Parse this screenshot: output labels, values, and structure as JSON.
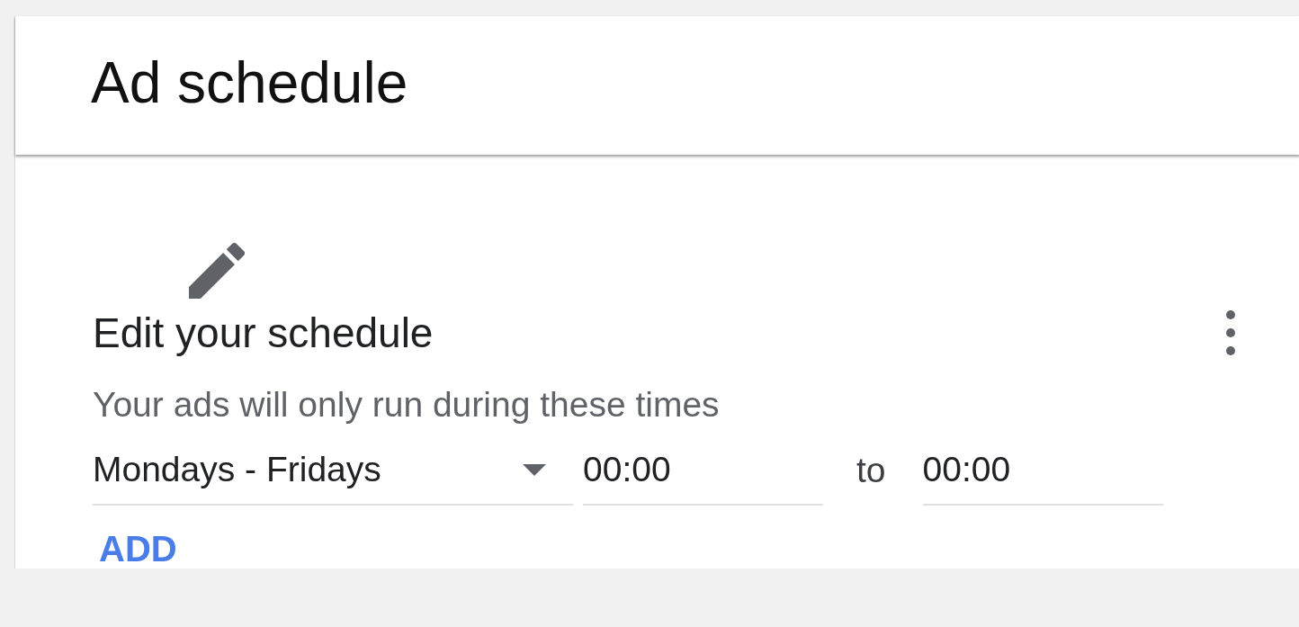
{
  "title": "Ad schedule",
  "section": {
    "title": "Edit your schedule",
    "subtitle": "Your ads will only run during these times"
  },
  "schedule_row": {
    "days": {
      "value": "Mondays - Fridays"
    },
    "start": {
      "value": "00:00"
    },
    "separator": "to",
    "end": {
      "value": "00:00"
    }
  },
  "add_button": "ADD"
}
